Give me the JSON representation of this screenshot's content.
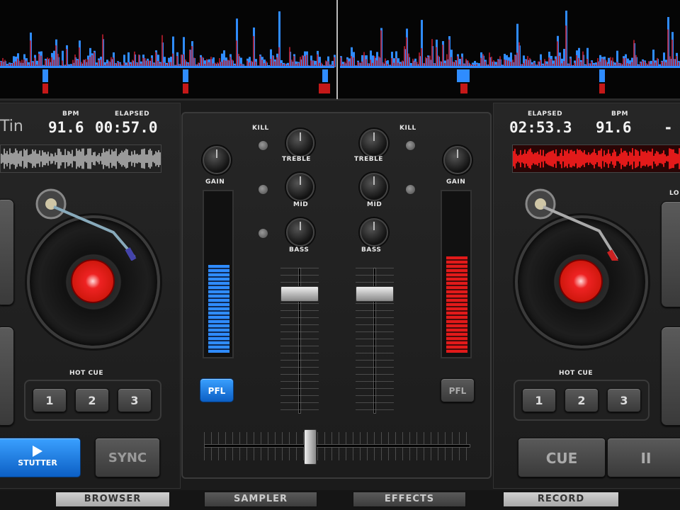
{
  "deck_left": {
    "title_fragment": "Tin",
    "bpm_label": "BPM",
    "bpm_value": "91.6",
    "elapsed_label": "ELAPSED",
    "elapsed_value": "00:57.0",
    "hot_cue_label": "HOT CUE",
    "hot_cues": [
      "1",
      "2",
      "3"
    ],
    "stutter_label": "STUTTER",
    "sync_label": "SYNC"
  },
  "deck_right": {
    "elapsed_label": "ELAPSED",
    "elapsed_value": "02:53.3",
    "bpm_label": "BPM",
    "bpm_value": "91.6",
    "edge_fragment": "-",
    "edge_label": "LO",
    "hot_cue_label": "HOT CUE",
    "hot_cues": [
      "1",
      "2",
      "3"
    ],
    "cue_label": "CUE",
    "pause_label": "II"
  },
  "mixer": {
    "kill_label": "KILL",
    "treble_label": "TREBLE",
    "mid_label": "MID",
    "bass_label": "BASS",
    "gain_label": "GAIN",
    "pfl_label": "PFL",
    "left_channel_level": 0.55,
    "right_channel_level": 0.6,
    "crossfader_position": 0.4
  },
  "bottom_tabs": [
    {
      "label": "BROWSER",
      "active": true
    },
    {
      "label": "SAMPLER",
      "active": false
    },
    {
      "label": "EFFECTS",
      "active": false
    },
    {
      "label": "RECORD",
      "active": true
    }
  ],
  "colors": {
    "deck_left_accent": "#2f8cff",
    "deck_right_accent": "#e21a1a",
    "panel": "#1e1e1e"
  }
}
